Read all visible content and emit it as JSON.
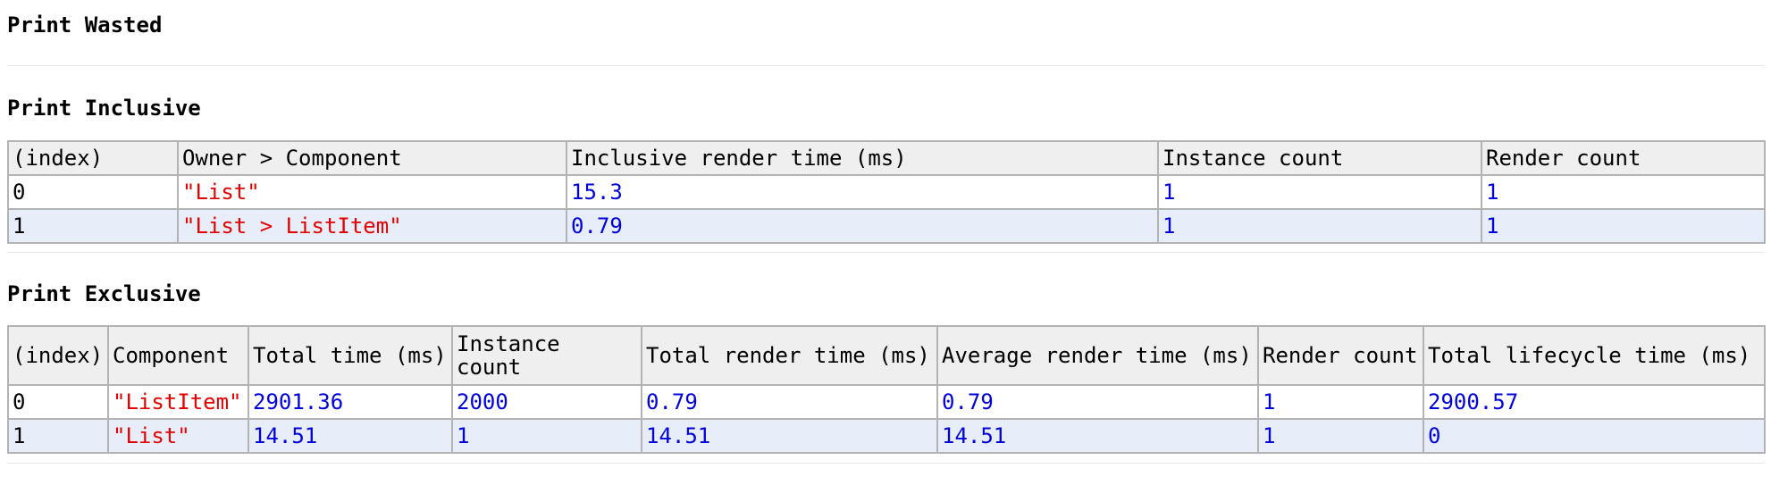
{
  "wasted": {
    "title": "Print Wasted"
  },
  "inclusive": {
    "title": "Print Inclusive",
    "columns": [
      "(index)",
      "Owner > Component",
      "Inclusive render time (ms)",
      "Instance count",
      "Render count"
    ],
    "rows": [
      [
        "0",
        "\"List\"",
        "15.3",
        "1",
        "1"
      ],
      [
        "1",
        "\"List > ListItem\"",
        "0.79",
        "1",
        "1"
      ]
    ]
  },
  "exclusive": {
    "title": "Print Exclusive",
    "columns": [
      "(index)",
      "Component",
      "Total time (ms)",
      "Instance count",
      "Total render time (ms)",
      "Average render time (ms)",
      "Render count",
      "Total lifecycle time (ms)"
    ],
    "rows": [
      [
        "0",
        "\"ListItem\"",
        "2901.36",
        "2000",
        "0.79",
        "0.79",
        "1",
        "2900.57"
      ],
      [
        "1",
        "\"List\"",
        "14.51",
        "1",
        "14.51",
        "14.51",
        "1",
        "0"
      ]
    ]
  },
  "colors": {
    "string_value": "#e30000",
    "number_value": "#0000dd",
    "header_bg": "#efefef",
    "alt_row_bg": "#e8eef9",
    "border": "#b3b3b3"
  }
}
